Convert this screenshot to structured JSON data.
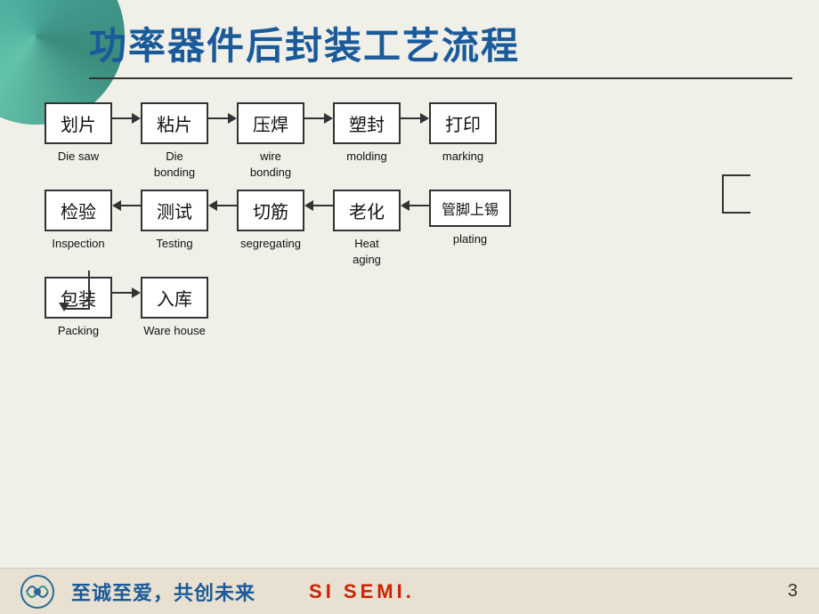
{
  "title": "功率器件后封装工艺流程",
  "row1": [
    {
      "zh": "划片",
      "en": "Die saw"
    },
    {
      "zh": "粘片",
      "en": "Die\nbonding"
    },
    {
      "zh": "压焊",
      "en": "wire\nbonding"
    },
    {
      "zh": "塑封",
      "en": "molding"
    },
    {
      "zh": "打印",
      "en": "marking"
    }
  ],
  "row2": [
    {
      "zh": "检验",
      "en": "Inspection"
    },
    {
      "zh": "测试",
      "en": "Testing"
    },
    {
      "zh": "切筋",
      "en": "segregating"
    },
    {
      "zh": "老化",
      "en": "Heat\naging"
    },
    {
      "zh": "管脚上锡",
      "en": "plating"
    }
  ],
  "row3": [
    {
      "zh": "包装",
      "en": "Packing"
    },
    {
      "zh": "入库",
      "en": "Ware house"
    }
  ],
  "footer": {
    "slogan": "至诚至爱，共创未来",
    "brand": "SI  SEMI.",
    "page": "3"
  }
}
